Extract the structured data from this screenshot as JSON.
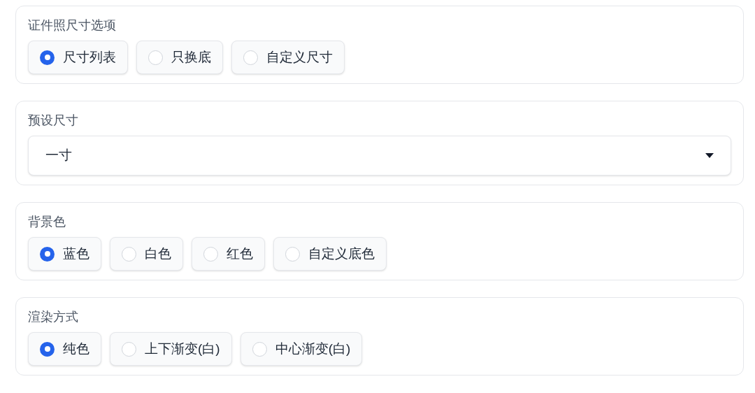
{
  "sections": [
    {
      "kind": "radio",
      "label": "证件照尺寸选项",
      "options": [
        {
          "label": "尺寸列表",
          "selected": true
        },
        {
          "label": "只换底",
          "selected": false
        },
        {
          "label": "自定义尺寸",
          "selected": false
        }
      ]
    },
    {
      "kind": "dropdown",
      "label": "预设尺寸",
      "value": "一寸"
    },
    {
      "kind": "radio",
      "label": "背景色",
      "options": [
        {
          "label": "蓝色",
          "selected": true
        },
        {
          "label": "白色",
          "selected": false
        },
        {
          "label": "红色",
          "selected": false
        },
        {
          "label": "自定义底色",
          "selected": false
        }
      ]
    },
    {
      "kind": "radio",
      "label": "渲染方式",
      "options": [
        {
          "label": "纯色",
          "selected": true
        },
        {
          "label": "上下渐变(白)",
          "selected": false
        },
        {
          "label": "中心渐变(白)",
          "selected": false
        }
      ]
    }
  ]
}
